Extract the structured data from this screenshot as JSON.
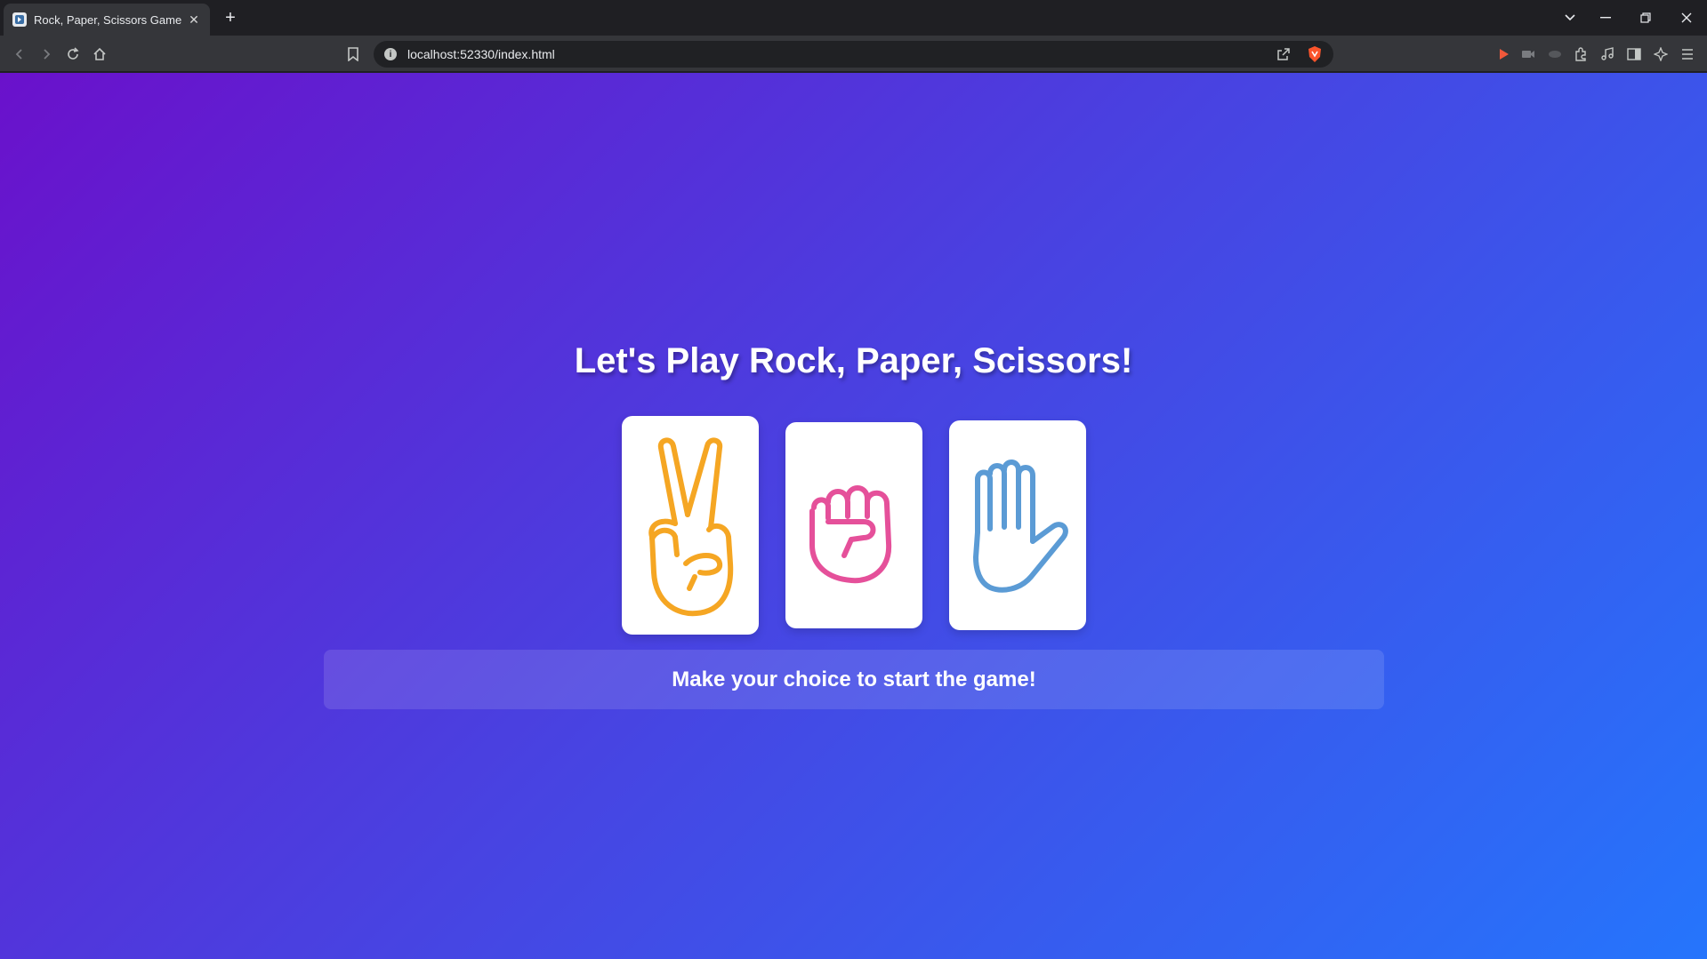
{
  "browser": {
    "tab_title": "Rock, Paper, Scissors Game",
    "url": "localhost:52330/index.html"
  },
  "page": {
    "heading": "Let's Play Rock, Paper, Scissors!",
    "status": "Make your choice to start the game!",
    "choices": [
      {
        "name": "scissors",
        "icon": "peace-hand-icon",
        "color": "#f5a623"
      },
      {
        "name": "rock",
        "icon": "fist-icon",
        "color": "#e5509a"
      },
      {
        "name": "paper",
        "icon": "open-hand-icon",
        "color": "#5b9bd5"
      }
    ],
    "gradient": {
      "start": "#6a11cb",
      "end": "#2575fc"
    }
  }
}
